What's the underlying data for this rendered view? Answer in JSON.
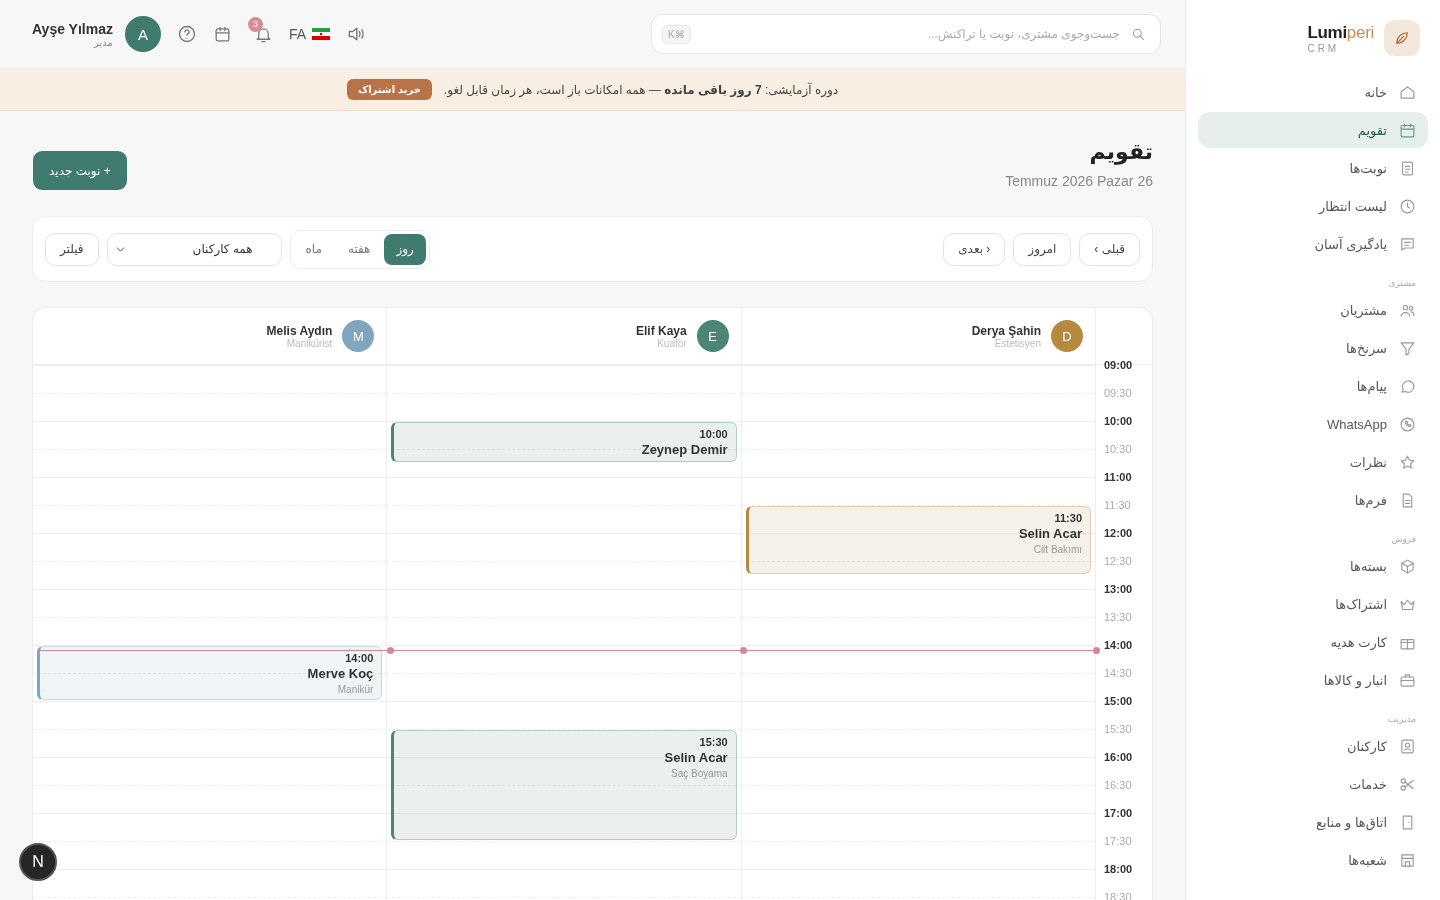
{
  "sidebar": {
    "brand": "Lumi",
    "brand_accent": "peri",
    "brand_sub": "CRM",
    "sections": [
      {
        "items": [
          {
            "label": "خانه",
            "selected": false
          },
          {
            "label": "تقویم",
            "selected": true
          },
          {
            "label": "نوبت‌ها",
            "selected": false
          },
          {
            "label": "لیست انتظار",
            "selected": false
          },
          {
            "label": "یادگیری آسان",
            "selected": false
          }
        ]
      },
      {
        "title": "مشتری",
        "items": [
          {
            "label": "مشتریان",
            "selected": false
          },
          {
            "label": "سرنخ‌ها",
            "selected": false
          },
          {
            "label": "پیام‌ها",
            "selected": false
          },
          {
            "label": "WhatsApp",
            "selected": false
          },
          {
            "label": "نظرات",
            "selected": false
          },
          {
            "label": "فرم‌ها",
            "selected": false
          }
        ]
      },
      {
        "title": "فروش",
        "items": [
          {
            "label": "بسته‌ها",
            "selected": false
          },
          {
            "label": "اشتراک‌ها",
            "selected": false
          },
          {
            "label": "کارت هدیه",
            "selected": false
          },
          {
            "label": "انبار و کالاها",
            "selected": false
          }
        ]
      },
      {
        "title": "مدیریت",
        "items": [
          {
            "label": "کارکنان",
            "selected": false
          },
          {
            "label": "خدمات",
            "selected": false
          },
          {
            "label": "اتاق‌ها و منابع",
            "selected": false
          },
          {
            "label": "شعبه‌ها",
            "selected": false
          }
        ]
      }
    ]
  },
  "header": {
    "search": {
      "placeholder": "جست‌وجوی مشتری، نوبت یا تراکنش...",
      "shortcut": "K⌘"
    },
    "language": "FA",
    "notifications": "3",
    "user": {
      "name": "Ayşe Yılmaz",
      "role": "مدیر",
      "initial": "A"
    }
  },
  "banner": {
    "text": "دوره آزمایشی: **7 روز باقی مانده** — همه امکانات باز است، هر زمان قابل لغو.",
    "button": "خرید اشتراک"
  },
  "page": {
    "title": "تقویم",
    "date": "Temmuz 2026 Pazar 26",
    "new_button": "+ نوبت جدید"
  },
  "toolbar": {
    "nav": [
      "قبلی ›",
      "امروز",
      "‹ بعدی"
    ],
    "views": [
      {
        "label": "روز",
        "selected": true
      },
      {
        "label": "هفته",
        "selected": false
      },
      {
        "label": "ماه",
        "selected": false
      }
    ],
    "staff_select": "همه کارکنان",
    "filter": "فیلتر"
  },
  "calendar": {
    "staff": [
      {
        "initial": "D",
        "name": "Derya Şahin",
        "role": "Estetisyen",
        "color": "#b58a3f",
        "events": [
          {
            "time": "11:30",
            "client": "Selin Acar",
            "service": "Cilt Bakımı",
            "color": "#b58a3f"
          }
        ]
      },
      {
        "initial": "E",
        "name": "Elif Kaya",
        "role": "Kuaför",
        "color": "#4a8576",
        "events": [
          {
            "time": "10:00",
            "client": "Zeynep Demir",
            "color": "#4a8576"
          },
          {
            "time": "15:30",
            "client": "Selin Acar",
            "service": "Saç Boyama",
            "color": "#4a8576"
          }
        ]
      },
      {
        "initial": "M",
        "name": "Melis Aydın",
        "role": "Manikürist",
        "color": "#7ea6bf",
        "events": [
          {
            "time": "14:00",
            "client": "Merve Koç",
            "service": "Manikür",
            "color": "#7ea6bf"
          }
        ]
      }
    ],
    "slots": [
      {
        "time": "09:00",
        "kind": "hour"
      },
      {
        "time": "09:30",
        "kind": "half"
      },
      {
        "time": "10:00",
        "kind": "hour"
      },
      {
        "time": "10:30",
        "kind": "half"
      },
      {
        "time": "11:00",
        "kind": "hour"
      },
      {
        "time": "11:30",
        "kind": "half"
      },
      {
        "time": "12:00",
        "kind": "hour"
      },
      {
        "time": "12:30",
        "kind": "half"
      },
      {
        "time": "13:00",
        "kind": "hour"
      },
      {
        "time": "13:30",
        "kind": "half"
      },
      {
        "time": "14:00",
        "kind": "hour"
      },
      {
        "time": "14:30",
        "kind": "half"
      },
      {
        "time": "15:00",
        "kind": "hour"
      },
      {
        "time": "15:30",
        "kind": "half"
      },
      {
        "time": "16:00",
        "kind": "hour"
      },
      {
        "time": "16:30",
        "kind": "half"
      },
      {
        "time": "17:00",
        "kind": "hour"
      },
      {
        "time": "17:30",
        "kind": "half"
      },
      {
        "time": "18:00",
        "kind": "hour"
      },
      {
        "time": "18:30",
        "kind": "half"
      }
    ]
  },
  "dev_badge": "N"
}
